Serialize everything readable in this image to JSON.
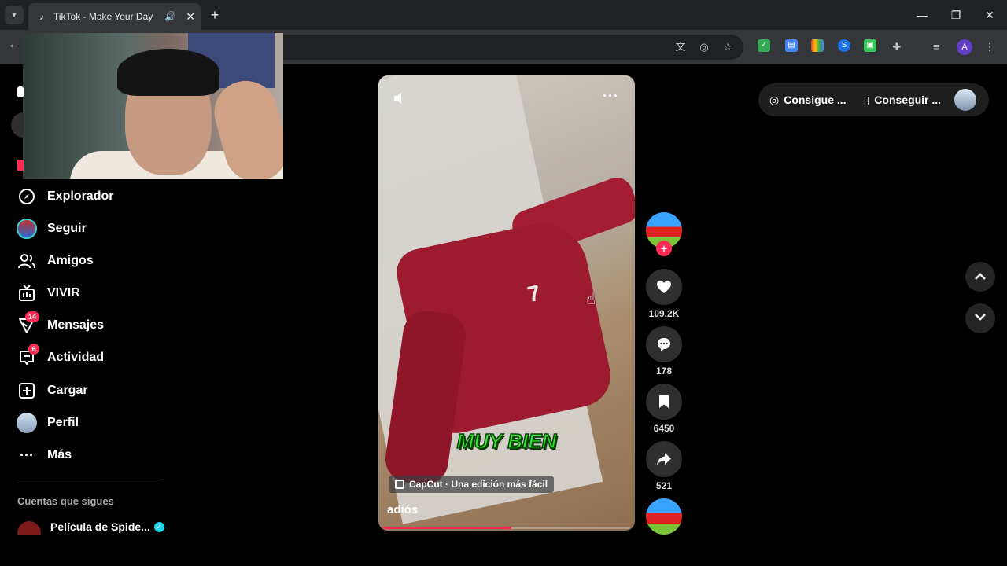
{
  "browser": {
    "tab_title": "TikTok - Make Your Day",
    "tab_favicon": "tiktok-icon",
    "new_tab_label": "+",
    "close_tab_label": "✕",
    "extensions": [
      "translate-icon",
      "eye-off-icon",
      "star-icon",
      "shield-ext",
      "docs-ext",
      "color-ext",
      "shazam-ext",
      "android-ext",
      "puzzle-ext",
      "media-icon"
    ],
    "profile_initial": "A"
  },
  "sidebar": {
    "items": [
      {
        "label": "Explorador",
        "icon": "compass-icon"
      },
      {
        "label": "Seguir",
        "icon": "following-avatar"
      },
      {
        "label": "Amigos",
        "icon": "friends-icon"
      },
      {
        "label": "VIVIR",
        "icon": "live-icon"
      },
      {
        "label": "Mensajes",
        "icon": "messages-icon",
        "badge": "14"
      },
      {
        "label": "Actividad",
        "icon": "activity-icon",
        "badge": "6"
      },
      {
        "label": "Cargar",
        "icon": "upload-icon"
      },
      {
        "label": "Perfil",
        "icon": "profile-avatar"
      },
      {
        "label": "Más",
        "icon": "more-icon"
      }
    ],
    "following_title": "Cuentas que sigues",
    "following": [
      {
        "name": "Película de Spide...",
        "verified": true
      }
    ]
  },
  "video": {
    "overlay_text": "MUY BIEN",
    "capcut_label": "CapCut · Una edición más fácil",
    "description": "adiós",
    "progress": 0.52
  },
  "actions": {
    "likes": "109.2K",
    "comments": "178",
    "saves": "6450",
    "shares": "521"
  },
  "topbar": {
    "coins_label": "Consigue ...",
    "app_label": "Conseguir ..."
  },
  "colors": {
    "accent": "#fe2c55",
    "caption": "#32e82a",
    "verified": "#20d5ec"
  }
}
